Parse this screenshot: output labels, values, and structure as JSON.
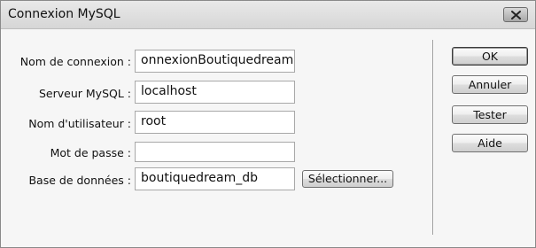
{
  "window": {
    "title": "Connexion MySQL"
  },
  "fields": [
    {
      "label": "Nom de connexion :",
      "value": "onnexionBoutiquedream"
    },
    {
      "label": "Serveur MySQL :",
      "value": "localhost"
    },
    {
      "label": "Nom d'utilisateur :",
      "value": "root"
    },
    {
      "label": "Mot de passe :",
      "value": ""
    },
    {
      "label": "Base de données :",
      "value": "boutiquedream_db"
    }
  ],
  "buttons": {
    "ok": "OK",
    "cancel": "Annuler",
    "test": "Tester",
    "help": "Aide",
    "select": "Sélectionner..."
  },
  "icons": {
    "close": "close-icon"
  }
}
